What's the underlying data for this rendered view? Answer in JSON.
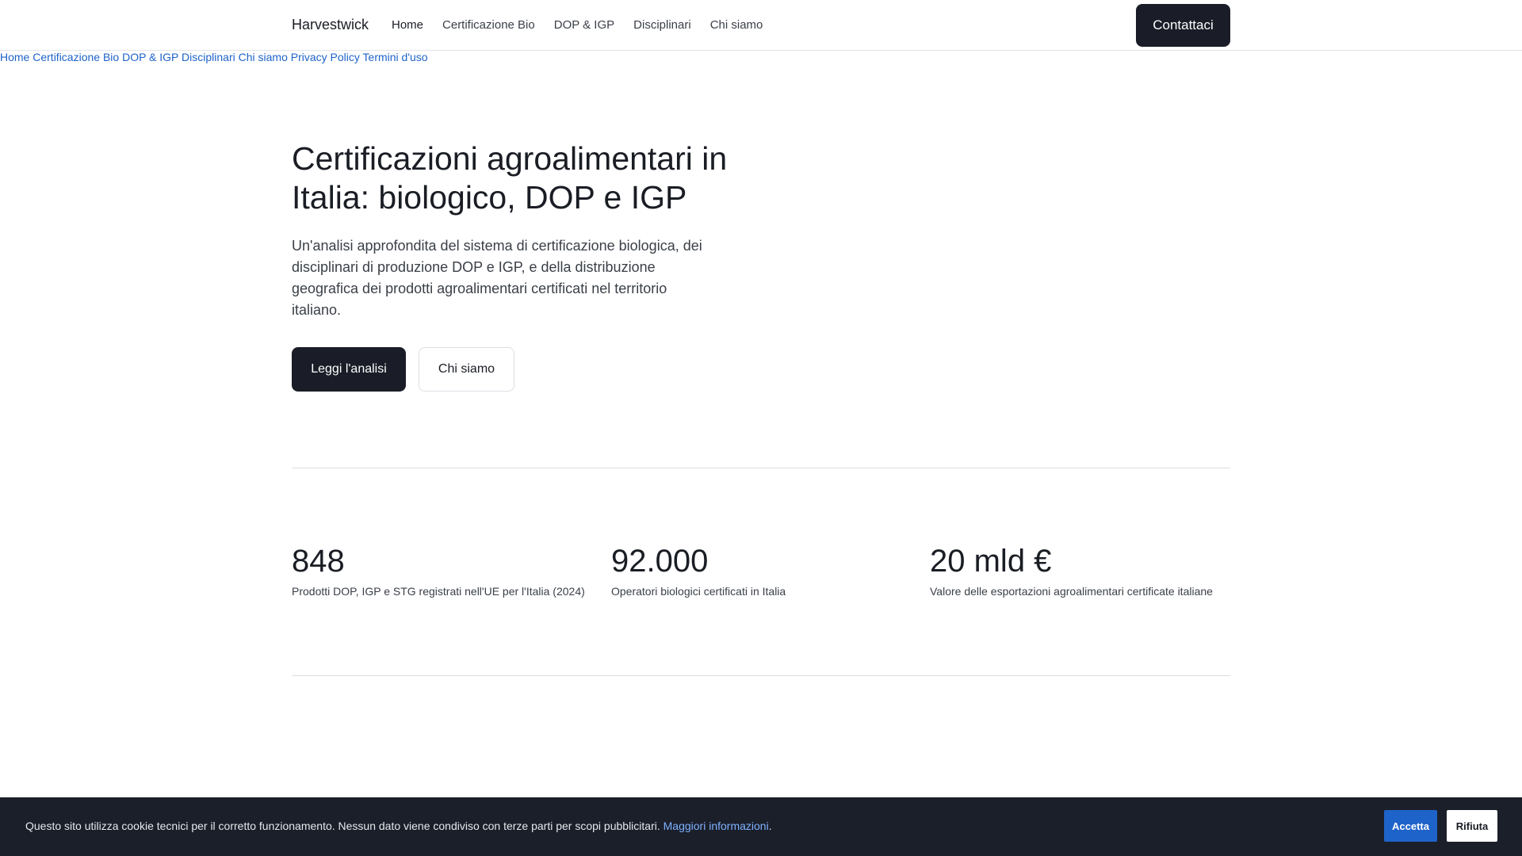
{
  "header": {
    "brand": "Harvestwick",
    "nav": [
      {
        "label": "Home"
      },
      {
        "label": "Certificazione Bio"
      },
      {
        "label": "DOP & IGP"
      },
      {
        "label": "Disciplinari"
      },
      {
        "label": "Chi siamo"
      }
    ],
    "cta_label": "Contattaci"
  },
  "link_bar": [
    {
      "label": "Home"
    },
    {
      "label": "Certificazione Bio"
    },
    {
      "label": "DOP & IGP"
    },
    {
      "label": "Disciplinari"
    },
    {
      "label": "Chi siamo"
    },
    {
      "label": "Privacy Policy"
    },
    {
      "label": "Termini d'uso"
    }
  ],
  "hero": {
    "title": "Certificazioni agroalimentari in Italia: biologico, DOP e IGP",
    "text": "Un'analisi approfondita del sistema di certificazione biologica, dei disciplinari di produzione DOP e IGP, e della distribuzione geografica dei prodotti agroalimentari certificati nel territorio italiano.",
    "primary_button": "Leggi l'analisi",
    "secondary_button": "Chi siamo"
  },
  "stats": [
    {
      "value": "848",
      "label": "Prodotti DOP, IGP e STG registrati nell'UE per l'Italia (2024)"
    },
    {
      "value": "92.000",
      "label": "Operatori biologici certificati in Italia"
    },
    {
      "value": "20 mld €",
      "label": "Valore delle esportazioni agroalimentari certificate italiane"
    }
  ],
  "cookie_banner": {
    "text": "Questo sito utilizza cookie tecnici per il corretto funzionamento. Nessun dato viene condiviso con terze parti per scopi pubblicitari.",
    "link_label": "Maggiori informazioni",
    "trailing": ".",
    "accept_label": "Accetta",
    "reject_label": "Rifiuta"
  },
  "colors": {
    "accent": "#1e63c9",
    "dark_button": "#1a1d27",
    "banner_background": "#1b1f2a"
  }
}
